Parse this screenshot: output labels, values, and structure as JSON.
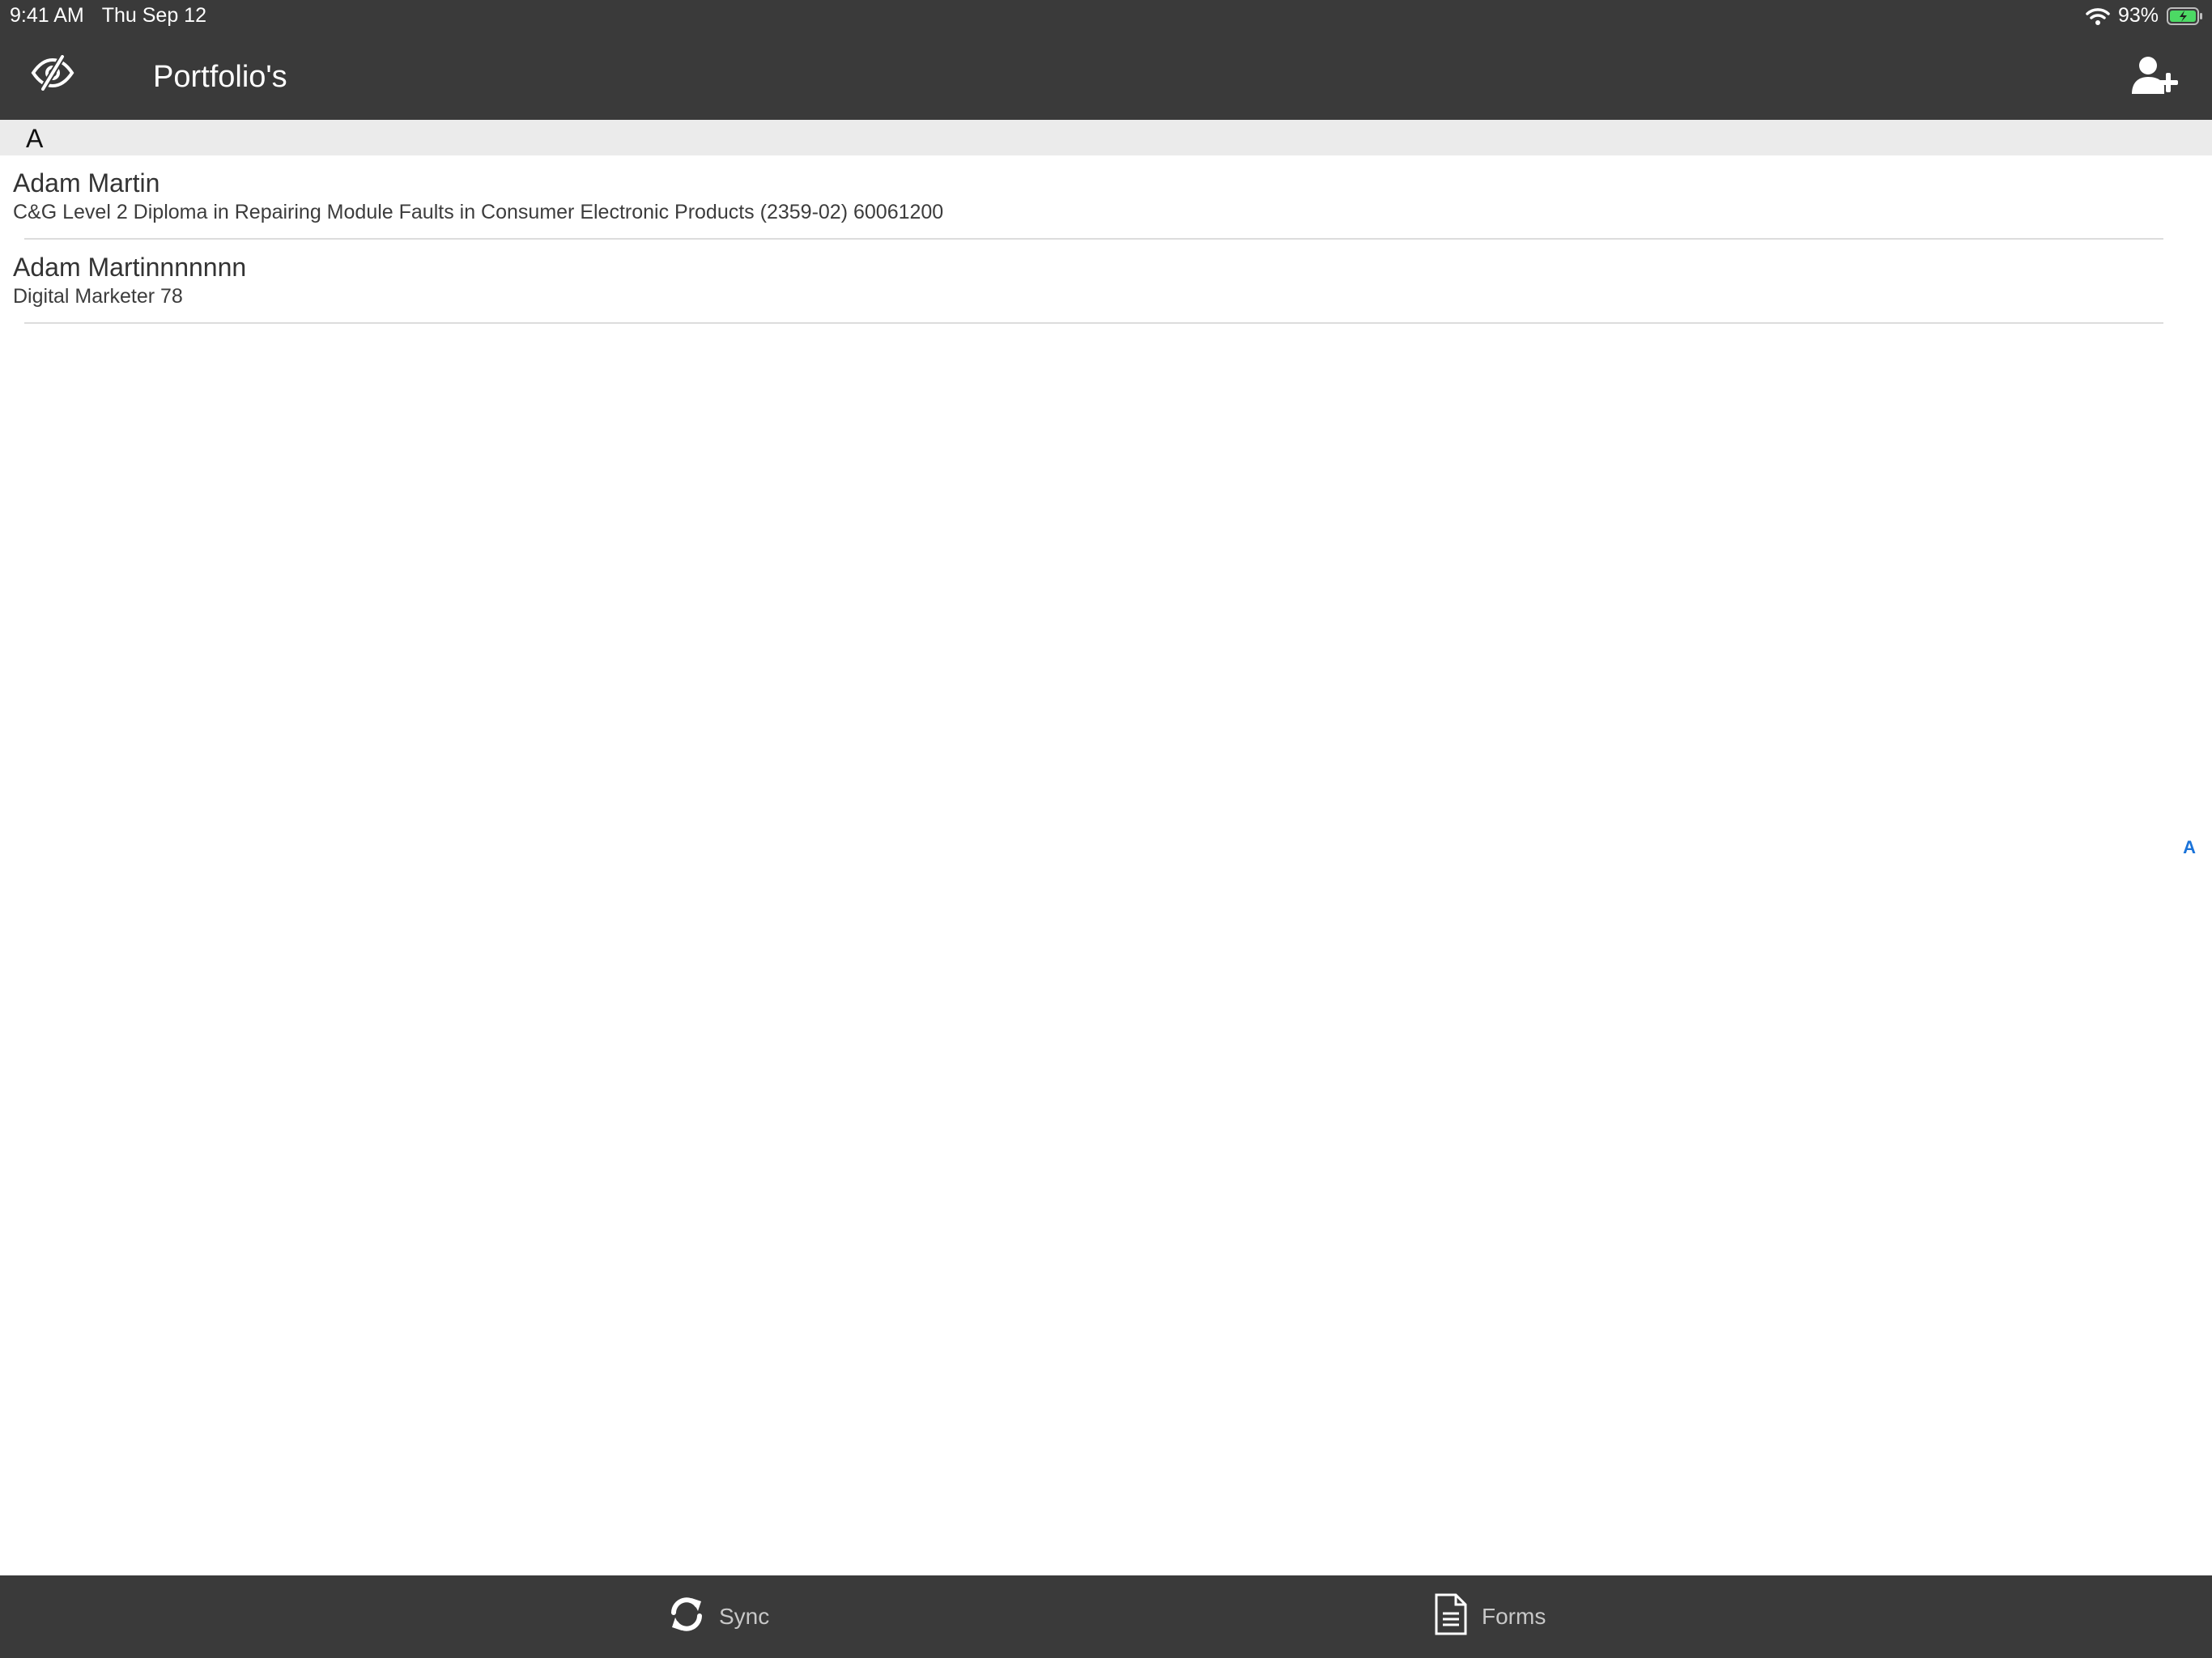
{
  "status_bar": {
    "time": "9:41 AM",
    "date": "Thu Sep 12",
    "battery": "93%"
  },
  "nav": {
    "title": "Portfolio's",
    "left_icon": "eye-slash-icon",
    "right_icon": "add-user-icon"
  },
  "section": {
    "letter": "A"
  },
  "portfolios": [
    {
      "name": "Adam Martin",
      "subtitle": "C&G Level 2 Diploma in Repairing Module Faults in Consumer Electronic Products (2359-02) 60061200"
    },
    {
      "name": "Adam Martinnnnnnn",
      "subtitle": "Digital Marketer 78"
    }
  ],
  "index": {
    "letter": "A"
  },
  "tabs": [
    {
      "label": "Sync",
      "icon": "sync-icon"
    },
    {
      "label": "Forms",
      "icon": "document-icon"
    }
  ],
  "colors": {
    "bar_background": "#3a3a3a",
    "section_background": "#ebebeb",
    "accent": "#1a73d9",
    "battery_green": "#4cd964"
  }
}
